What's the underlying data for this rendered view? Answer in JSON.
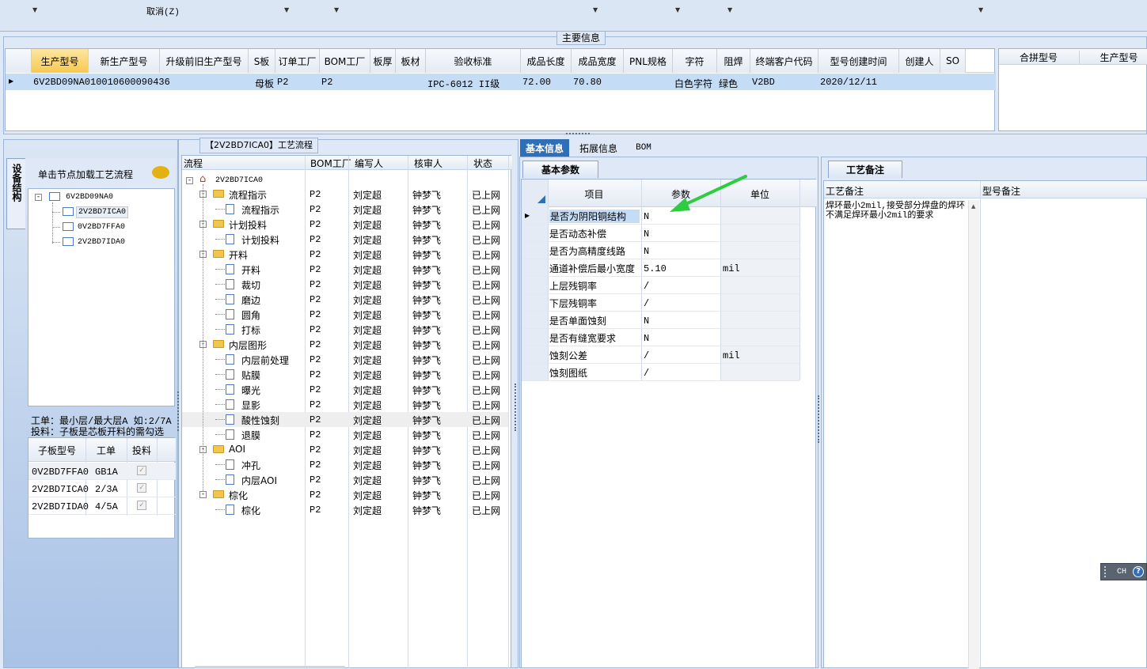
{
  "toolbar": {
    "cancel_label": "取消(Z)"
  },
  "main_info": {
    "section_label": "主要信息",
    "columns": [
      "生产型号",
      "新生产型号",
      "升级前旧生产型号",
      "S板",
      "订单工厂",
      "BOM工厂",
      "板厚",
      "板材",
      "验收标准",
      "成品长度",
      "成品宽度",
      "PNL规格",
      "字符",
      "阻焊",
      "终端客户代码",
      "型号创建时间",
      "创建人",
      "SO"
    ],
    "row": [
      "6V2BD09NA0",
      "10010600090436",
      "",
      "母板",
      "P2",
      "P2",
      "",
      "",
      "IPC-6012 II级",
      "72.00",
      "70.80",
      "",
      "白色字符",
      "绿色",
      "V2BD",
      "2020/12/11",
      "",
      ""
    ],
    "merge_columns": [
      "合拼型号",
      "生产型号"
    ]
  },
  "left_panel": {
    "vertical_tab": "设备结构",
    "hint": "单击节点加载工艺流程",
    "tree": [
      "6V2BD09NA0",
      "2V2BD7ICA0",
      "0V2BD7FFA0",
      "2V2BD7IDA0"
    ],
    "note_line1": "工单：最小层/最大层A 如:2/7A",
    "note_line2": "投料：子板是芯板开料的需勾选",
    "sub_columns": [
      "子板型号",
      "工单",
      "投料"
    ],
    "sub_rows": [
      {
        "model": "0V2BD7FFA0",
        "order": "GB1A"
      },
      {
        "model": "2V2BD7ICA0",
        "order": "2/3A"
      },
      {
        "model": "2V2BD7IDA0",
        "order": "4/5A"
      }
    ]
  },
  "flow_panel": {
    "title": "【2V2BD7ICA0】工艺流程",
    "columns": [
      "流程",
      "BOM工厂",
      "编写人",
      "核审人",
      "状态"
    ],
    "root": "2V2BD7ICA0",
    "rows": [
      {
        "name": "流程指示",
        "level": 1,
        "factory": "P2",
        "writer": "刘定超",
        "reviewer": "钟梦飞",
        "status": "已上网"
      },
      {
        "name": "流程指示",
        "level": 2,
        "factory": "P2",
        "writer": "刘定超",
        "reviewer": "钟梦飞",
        "status": "已上网"
      },
      {
        "name": "计划投料",
        "level": 1,
        "factory": "P2",
        "writer": "刘定超",
        "reviewer": "钟梦飞",
        "status": "已上网"
      },
      {
        "name": "计划投料",
        "level": 2,
        "factory": "P2",
        "writer": "刘定超",
        "reviewer": "钟梦飞",
        "status": "已上网"
      },
      {
        "name": "开料",
        "level": 1,
        "factory": "P2",
        "writer": "刘定超",
        "reviewer": "钟梦飞",
        "status": "已上网"
      },
      {
        "name": "开料",
        "level": 2,
        "factory": "P2",
        "writer": "刘定超",
        "reviewer": "钟梦飞",
        "status": "已上网"
      },
      {
        "name": "裁切",
        "level": 2,
        "factory": "P2",
        "writer": "刘定超",
        "reviewer": "钟梦飞",
        "status": "已上网"
      },
      {
        "name": "磨边",
        "level": 2,
        "factory": "P2",
        "writer": "刘定超",
        "reviewer": "钟梦飞",
        "status": "已上网"
      },
      {
        "name": "圆角",
        "level": 2,
        "factory": "P2",
        "writer": "刘定超",
        "reviewer": "钟梦飞",
        "status": "已上网"
      },
      {
        "name": "打标",
        "level": 2,
        "factory": "P2",
        "writer": "刘定超",
        "reviewer": "钟梦飞",
        "status": "已上网"
      },
      {
        "name": "内层图形",
        "level": 1,
        "factory": "P2",
        "writer": "刘定超",
        "reviewer": "钟梦飞",
        "status": "已上网"
      },
      {
        "name": "内层前处理",
        "level": 2,
        "factory": "P2",
        "writer": "刘定超",
        "reviewer": "钟梦飞",
        "status": "已上网"
      },
      {
        "name": "贴膜",
        "level": 2,
        "factory": "P2",
        "writer": "刘定超",
        "reviewer": "钟梦飞",
        "status": "已上网"
      },
      {
        "name": "曝光",
        "level": 2,
        "factory": "P2",
        "writer": "刘定超",
        "reviewer": "钟梦飞",
        "status": "已上网"
      },
      {
        "name": "显影",
        "level": 2,
        "factory": "P2",
        "writer": "刘定超",
        "reviewer": "钟梦飞",
        "status": "已上网"
      },
      {
        "name": "酸性蚀刻",
        "level": 2,
        "factory": "P2",
        "writer": "刘定超",
        "reviewer": "钟梦飞",
        "status": "已上网",
        "selected": true
      },
      {
        "name": "退膜",
        "level": 2,
        "factory": "P2",
        "writer": "刘定超",
        "reviewer": "钟梦飞",
        "status": "已上网"
      },
      {
        "name": "AOI",
        "level": 1,
        "factory": "P2",
        "writer": "刘定超",
        "reviewer": "钟梦飞",
        "status": "已上网"
      },
      {
        "name": "冲孔",
        "level": 2,
        "factory": "P2",
        "writer": "刘定超",
        "reviewer": "钟梦飞",
        "status": "已上网"
      },
      {
        "name": "内层AOI",
        "level": 2,
        "factory": "P2",
        "writer": "刘定超",
        "reviewer": "钟梦飞",
        "status": "已上网"
      },
      {
        "name": "棕化",
        "level": 1,
        "factory": "P2",
        "writer": "刘定超",
        "reviewer": "钟梦飞",
        "status": "已上网"
      },
      {
        "name": "棕化",
        "level": 2,
        "factory": "P2",
        "writer": "刘定超",
        "reviewer": "钟梦飞",
        "status": "已上网"
      }
    ]
  },
  "right_tabs": [
    "基本信息",
    "拓展信息",
    "BOM"
  ],
  "basic_params": {
    "tab": "基本参数",
    "columns": [
      "项目",
      "参数",
      "单位"
    ],
    "rows": [
      {
        "item": "是否为阴阳铜结构",
        "value": "N",
        "unit": ""
      },
      {
        "item": "是否动态补偿",
        "value": "N",
        "unit": ""
      },
      {
        "item": "是否为高精度线路",
        "value": "N",
        "unit": ""
      },
      {
        "item": "通道补偿后最小宽度",
        "value": "5.10",
        "unit": "mil"
      },
      {
        "item": "上层残铜率",
        "value": "/",
        "unit": ""
      },
      {
        "item": "下层残铜率",
        "value": "/",
        "unit": ""
      },
      {
        "item": "是否单面蚀刻",
        "value": "N",
        "unit": ""
      },
      {
        "item": "是否有缝宽要求",
        "value": "N",
        "unit": ""
      },
      {
        "item": "蚀刻公差",
        "value": "/",
        "unit": "mil"
      },
      {
        "item": "蚀刻图纸",
        "value": "/",
        "unit": ""
      }
    ]
  },
  "process_note": {
    "tab": "工艺备注",
    "col1": "工艺备注",
    "col2": "型号备注",
    "text": "焊环最小2mil,接受部分焊盘的焊环不满足焊环最小2mil的要求"
  },
  "ime": {
    "label": "CH"
  },
  "colors": {
    "accent": "#2f6fb7",
    "selected": "#c5dcf7",
    "arrow": "#2ecc40"
  }
}
